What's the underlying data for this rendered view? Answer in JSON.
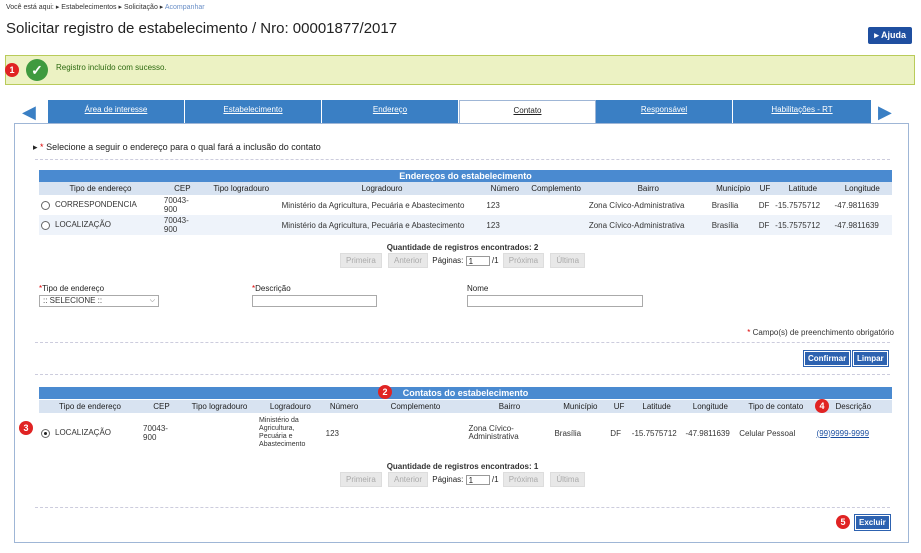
{
  "breadcrumb": {
    "prefix": "Você está aqui:",
    "items": [
      "Estabelecimentos",
      "Solicitação"
    ],
    "current": "Acompanhar",
    "sep": "▸"
  },
  "title": "Solicitar registro de estabelecimento / Nro: 00001877/2017",
  "help_label": "Ajuda",
  "success_message": "Registro incluído com sucesso.",
  "markers": [
    "1",
    "2",
    "3",
    "4",
    "5"
  ],
  "tabs": [
    "Área de interesse",
    "Estabelecimento",
    "Endereço",
    "Contato",
    "Responsável",
    "Habilitações - RT"
  ],
  "active_tab": "Contato",
  "instruction": "Selecione a seguir o endereço para o qual fará a inclusão do contato",
  "addresses": {
    "title": "Endereços do estabelecimento",
    "columns": [
      "Tipo de endereço",
      "CEP",
      "Tipo logradouro",
      "Logradouro",
      "Número",
      "Complemento",
      "Bairro",
      "Município",
      "UF",
      "Latitude",
      "Longitude"
    ],
    "rows": [
      [
        "CORRESPONDENCIA",
        "70043-900",
        "",
        "Ministério da Agricultura, Pecuária e Abastecimento",
        "123",
        "",
        "Zona Cívico-Administrativa",
        "Brasília",
        "DF",
        "-15.7575712",
        "-47.9811639"
      ],
      [
        "LOCALIZAÇÃO",
        "70043-900",
        "",
        "Ministério da Agricultura, Pecuária e Abastecimento",
        "123",
        "",
        "Zona Cívico-Administrativa",
        "Brasília",
        "DF",
        "-15.7575712",
        "-47.9811639"
      ]
    ]
  },
  "pager1": {
    "count_label": "Quantidade de registros encontrados:",
    "count": "2",
    "first": "Primeira",
    "prev": "Anterior",
    "pages_label": "Páginas:",
    "page": "1",
    "total": "/1",
    "next": "Próxima",
    "last": "Última"
  },
  "form": {
    "tipo_label": "Tipo de endereço",
    "tipo_value": ":: SELECIONE ::",
    "descricao_label": "Descrição",
    "nome_label": "Nome",
    "required_note": "Campo(s) de preenchimento obrigatório",
    "confirm": "Confirmar",
    "clear": "Limpar"
  },
  "contacts": {
    "title": "Contatos do estabelecimento",
    "columns": [
      "Tipo de endereço",
      "CEP",
      "Tipo logradouro",
      "Logradouro",
      "Número",
      "Complemento",
      "Bairro",
      "Município",
      "UF",
      "Latitude",
      "Longitude",
      "Tipo de contato",
      "Descrição"
    ],
    "row": {
      "tipo": "LOCALIZAÇÃO",
      "cep": "70043-900",
      "tipo_logradouro": "",
      "logradouro": "Ministério da Agricultura, Pecuária e Abastecimento",
      "numero": "123",
      "complemento": "",
      "bairro": "Zona Cívico-Administrativa",
      "municipio": "Brasília",
      "uf": "DF",
      "latitude": "-15.7575712",
      "longitude": "-47.9811639",
      "tipo_contato": "Celular Pessoal",
      "descricao": "(99)9999-9999"
    }
  },
  "pager2": {
    "count_label": "Quantidade de registros encontrados:",
    "count": "1",
    "first": "Primeira",
    "prev": "Anterior",
    "pages_label": "Páginas:",
    "page": "1",
    "total": "/1",
    "next": "Próxima",
    "last": "Última"
  },
  "delete_label": "Excluir",
  "colors": {
    "primary": "#3a7fc4",
    "success_bg": "#ecf2c3",
    "marker": "#e02323"
  }
}
